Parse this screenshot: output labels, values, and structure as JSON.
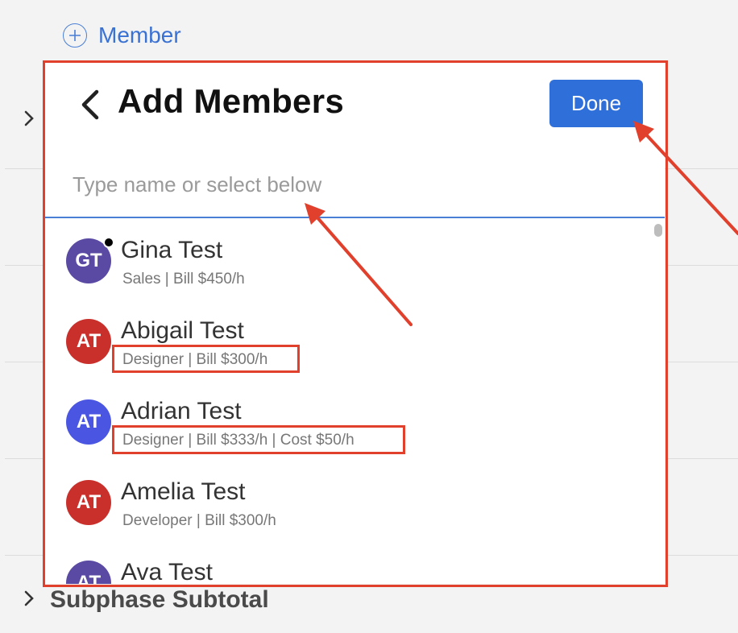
{
  "background": {
    "add_member_label": "Member",
    "subtotal_label": "Subphase Subtotal"
  },
  "modal": {
    "title": "Add Members",
    "done_label": "Done",
    "search_placeholder": "Type name or select below"
  },
  "members": [
    {
      "initials": "GT",
      "name": "Gina Test",
      "detail": "Sales | Bill $450/h",
      "avatar_color": "#5a4aa3",
      "online": true
    },
    {
      "initials": "AT",
      "name": "Abigail Test",
      "detail": "Designer | Bill $300/h",
      "avatar_color": "#c9302c",
      "online": false
    },
    {
      "initials": "AT",
      "name": "Adrian Test",
      "detail": "Designer | Bill $333/h | Cost $50/h",
      "avatar_color": "#4a56e2",
      "online": false
    },
    {
      "initials": "AT",
      "name": "Amelia Test",
      "detail": "Developer | Bill $300/h",
      "avatar_color": "#c9302c",
      "online": false
    },
    {
      "initials": "AT",
      "name": "Ava Test",
      "detail": "",
      "avatar_color": "#5a4aa3",
      "online": false
    }
  ],
  "annotation_color": "#e0402c"
}
